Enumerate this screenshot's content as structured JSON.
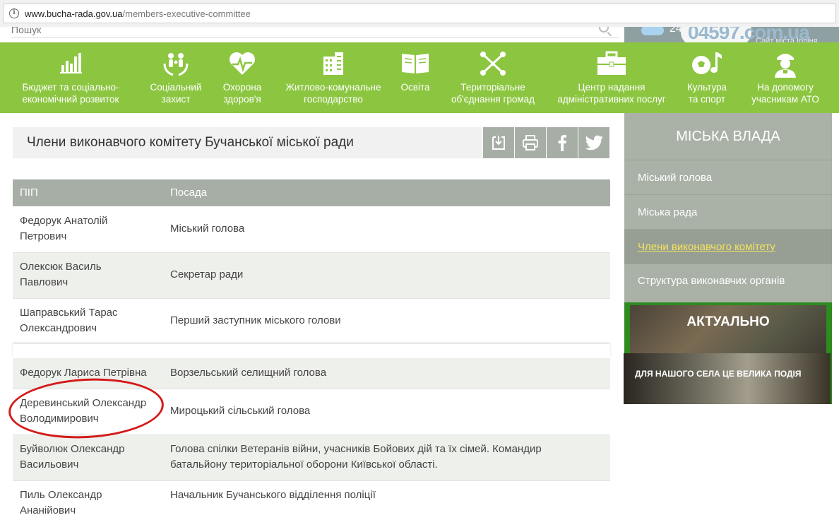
{
  "browser": {
    "url_host": "www.bucha-rada.gov.ua",
    "url_path": "/members-executive-committee"
  },
  "header": {
    "search_placeholder": "Пошук",
    "temperature": "24",
    "logo_text": "04597.com.ua",
    "logo_subtitle": "Сайт міста Ірпіня"
  },
  "nav": {
    "items": [
      {
        "label_line1": "Бюджет та соціально-",
        "label_line2": "економічний розвиток",
        "icon": "chart-icon"
      },
      {
        "label_line1": "Соціальний",
        "label_line2": "захист",
        "icon": "family-icon"
      },
      {
        "label_line1": "Охорона",
        "label_line2": "здоров'я",
        "icon": "heart-icon"
      },
      {
        "label_line1": "Житлово-комунальне",
        "label_line2": "господарство",
        "icon": "building-icon"
      },
      {
        "label_line1": "Освіта",
        "label_line2": "",
        "icon": "book-icon"
      },
      {
        "label_line1": "Територіальне",
        "label_line2": "об'єднання громад",
        "icon": "network-icon"
      },
      {
        "label_line1": "Центр надання",
        "label_line2": "адміністративних послуг",
        "icon": "briefcase-icon"
      },
      {
        "label_line1": "Культура",
        "label_line2": "та спорт",
        "icon": "ball-music-icon"
      },
      {
        "label_line1": "На допомогу",
        "label_line2": "учасникам АТО",
        "icon": "soldier-icon"
      }
    ]
  },
  "page": {
    "title": "Члени виконавчого комітету Бучанської міської ради"
  },
  "table": {
    "headers": [
      "ПІП",
      "Посада"
    ],
    "rows": [
      {
        "name1": "Федорук Анатолій",
        "name2": "Петрович",
        "position1": "Міський голова",
        "position2": ""
      },
      {
        "name1": "Олексюк Василь",
        "name2": "Павлович",
        "position1": "Секретар ради",
        "position2": ""
      },
      {
        "name1": "Шаправський Тарас",
        "name2": "Олександрович",
        "position1": "Перший заступник міського голови",
        "position2": ""
      },
      {
        "name1": "Федорук Лариса Петрівна",
        "name2": "",
        "position1": "Ворзельський селищний голова",
        "position2": ""
      },
      {
        "name1": "Деревинський Олександр",
        "name2": "Володимирович",
        "position1": "Мироцький сільський голова",
        "position2": ""
      },
      {
        "name1": "Буйволюк Олександр",
        "name2": "Васильович",
        "position1": "Голова спілки Ветеранів війни, учасників Бойових дій та їх сімей. Командир",
        "position2": "батальйону територіальної оборони Київської області."
      },
      {
        "name1": "Пиль Олександр",
        "name2": "Ананійович",
        "position1": "Начальник Бучанського відділення поліції",
        "position2": ""
      }
    ]
  },
  "sidebar": {
    "title": "МІСЬКА ВЛАДА",
    "items": [
      {
        "label": "Міський голова"
      },
      {
        "label": "Міська рада"
      },
      {
        "label": "Члени виконавчого комітету"
      },
      {
        "label": "Структура виконавчих органів"
      }
    ],
    "active_index": 2
  },
  "news": {
    "title": "АКТУАЛЬНО",
    "caption": "ДЛЯ НАШОГО СЕЛА ЦЕ ВЕЛИКА ПОДІЯ"
  },
  "colors": {
    "nav_green": "#8cc641",
    "grey": "#a7aea6",
    "highlight_red": "#d41a1a",
    "active_link": "#f5e35b"
  }
}
